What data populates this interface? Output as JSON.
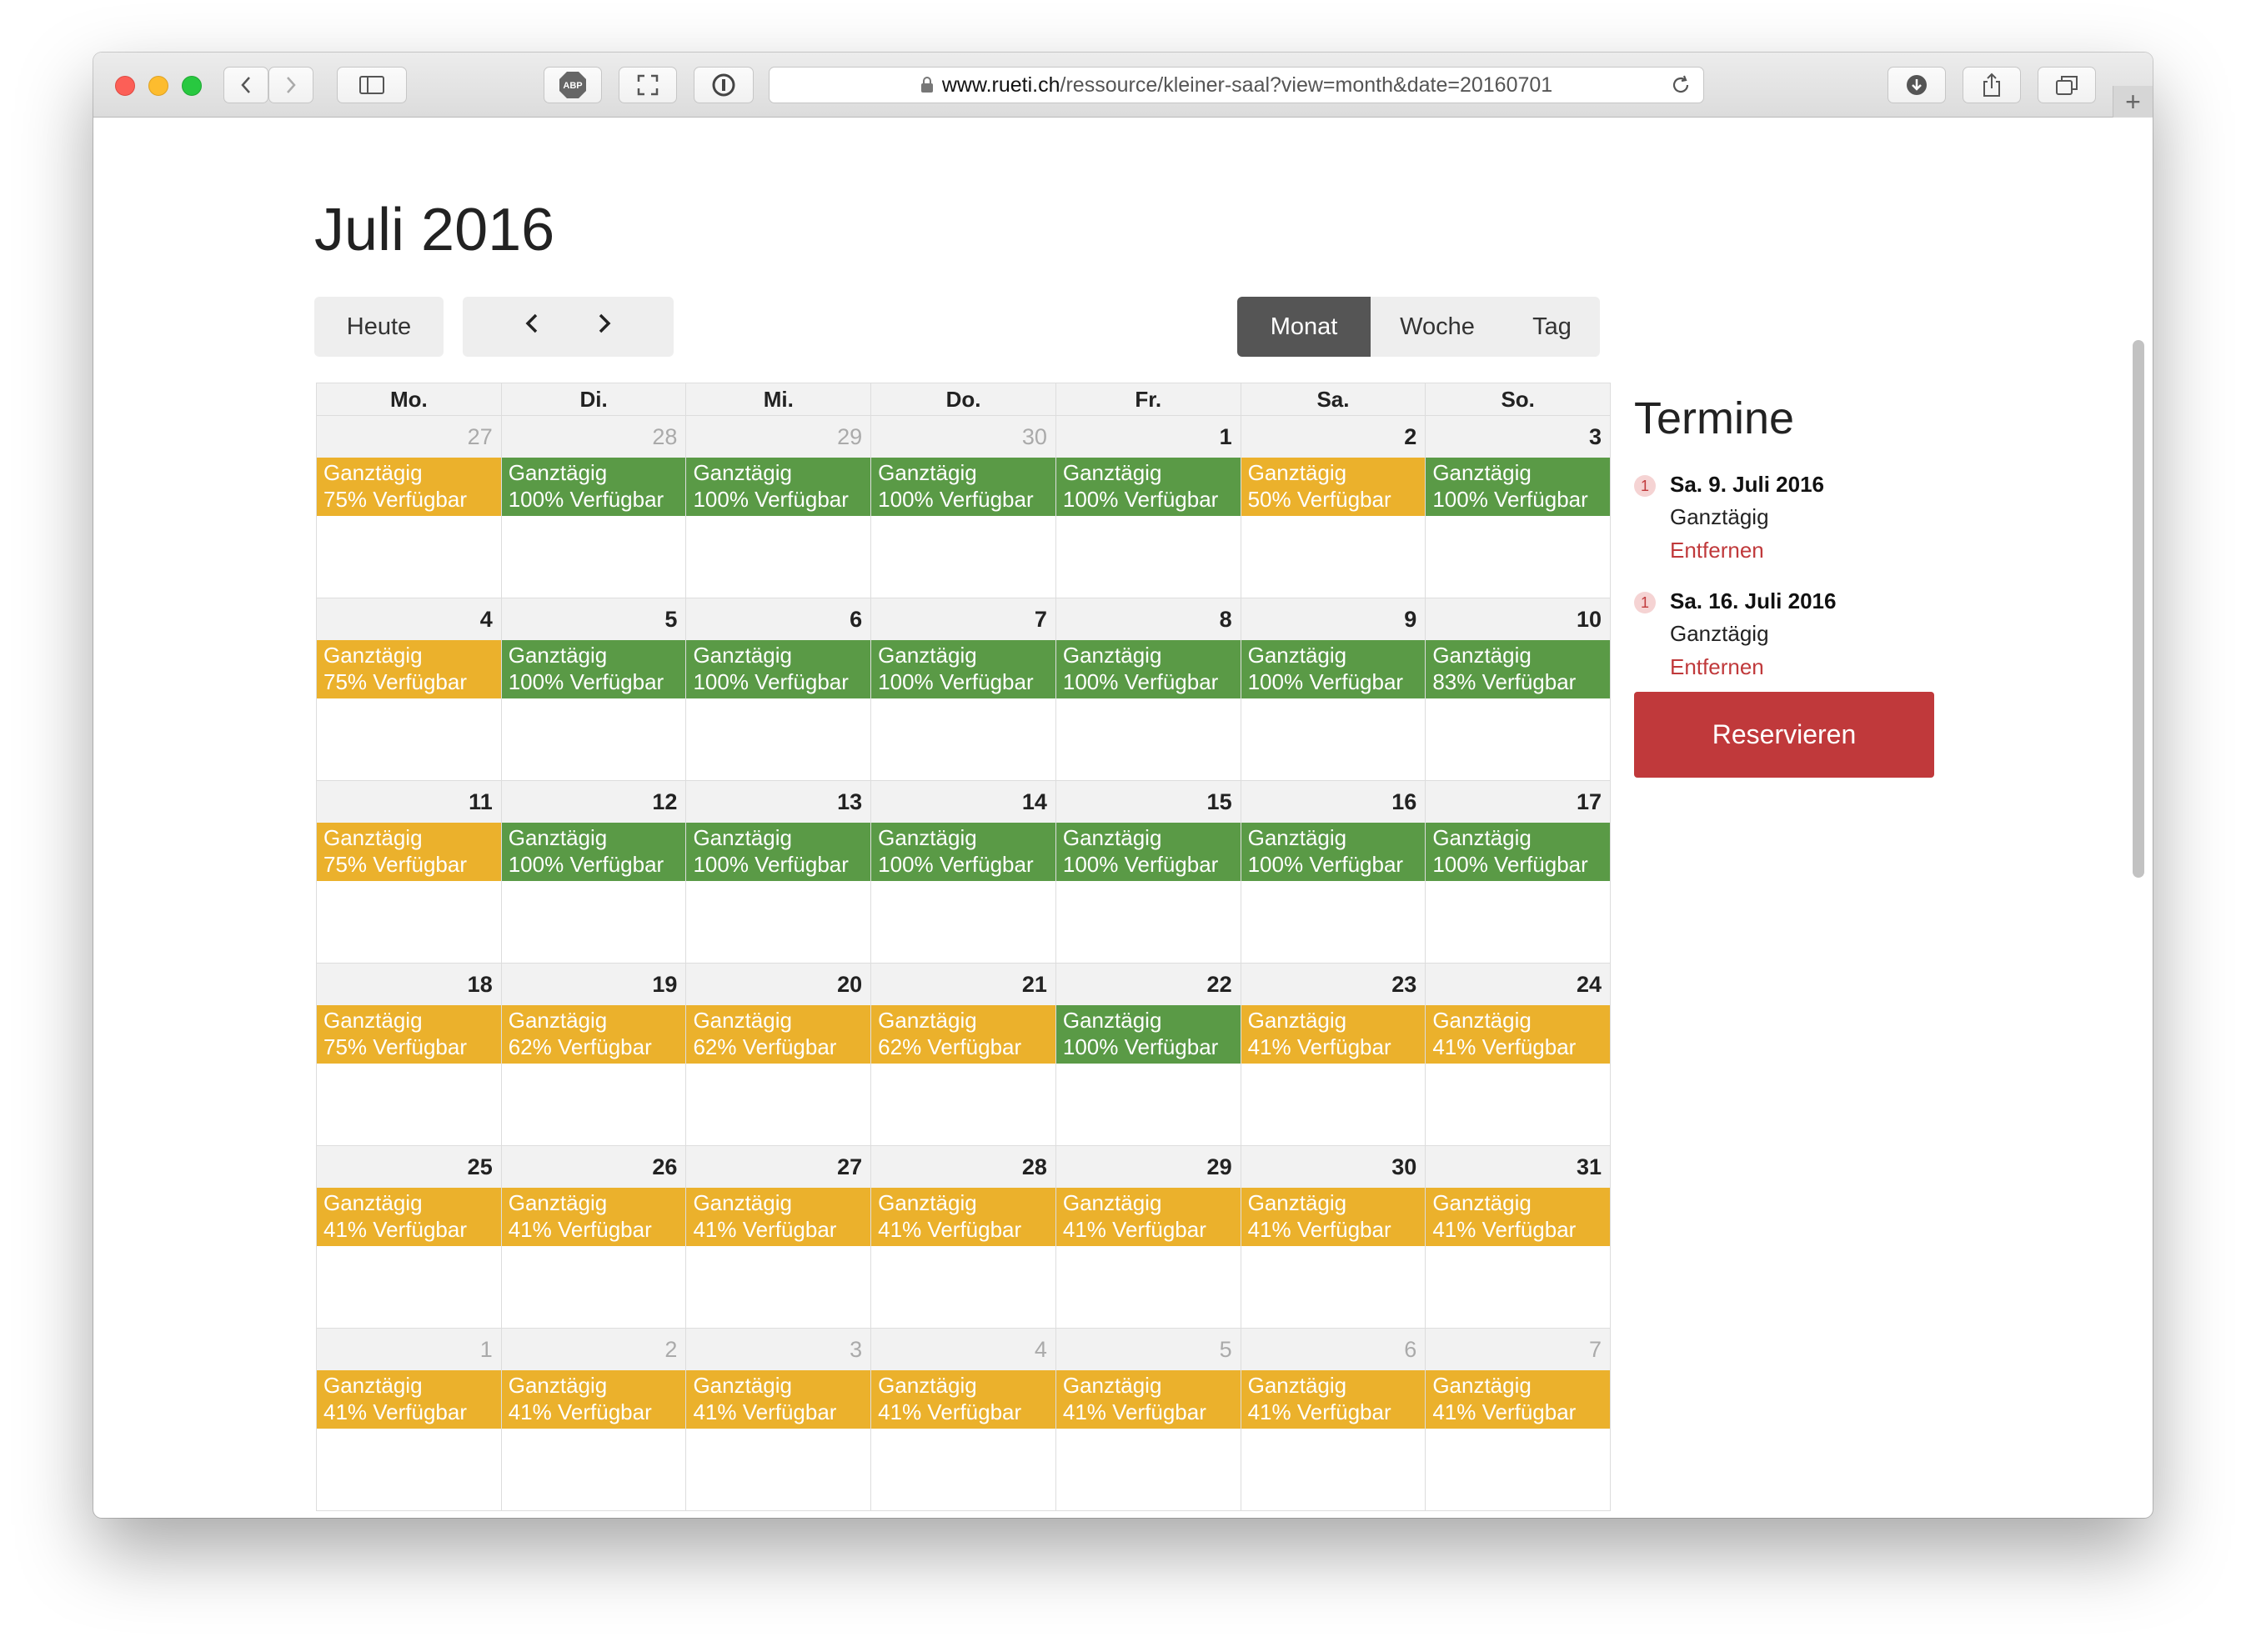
{
  "browser": {
    "url_domain": "www.rueti.ch",
    "url_path": "/ressource/kleiner-saal?view=month&date=20160701",
    "adblock_label": "ABP"
  },
  "page": {
    "title": "Juli 2016"
  },
  "controls": {
    "today": "Heute",
    "prev": "‹",
    "next": "›",
    "views": [
      "Monat",
      "Woche",
      "Tag"
    ],
    "active_view": "Monat"
  },
  "colors": {
    "available": "#5a9a46",
    "partial": "#ebb12c",
    "accent": "#c0393b"
  },
  "calendar": {
    "weekdays": [
      "Mo.",
      "Di.",
      "Mi.",
      "Do.",
      "Fr.",
      "Sa.",
      "So."
    ],
    "weeks": [
      [
        {
          "day": "27",
          "other": true,
          "label": "Ganztägig",
          "avail": "75% Verfügbar",
          "status": "yellow"
        },
        {
          "day": "28",
          "other": true,
          "label": "Ganztägig",
          "avail": "100% Verfügbar",
          "status": "green"
        },
        {
          "day": "29",
          "other": true,
          "label": "Ganztägig",
          "avail": "100% Verfügbar",
          "status": "green"
        },
        {
          "day": "30",
          "other": true,
          "label": "Ganztägig",
          "avail": "100% Verfügbar",
          "status": "green"
        },
        {
          "day": "1",
          "other": false,
          "label": "Ganztägig",
          "avail": "100% Verfügbar",
          "status": "green"
        },
        {
          "day": "2",
          "other": false,
          "label": "Ganztägig",
          "avail": "50% Verfügbar",
          "status": "yellow"
        },
        {
          "day": "3",
          "other": false,
          "label": "Ganztägig",
          "avail": "100% Verfügbar",
          "status": "green"
        }
      ],
      [
        {
          "day": "4",
          "other": false,
          "label": "Ganztägig",
          "avail": "75% Verfügbar",
          "status": "yellow"
        },
        {
          "day": "5",
          "other": false,
          "label": "Ganztägig",
          "avail": "100% Verfügbar",
          "status": "green"
        },
        {
          "day": "6",
          "other": false,
          "label": "Ganztägig",
          "avail": "100% Verfügbar",
          "status": "green"
        },
        {
          "day": "7",
          "other": false,
          "label": "Ganztägig",
          "avail": "100% Verfügbar",
          "status": "green"
        },
        {
          "day": "8",
          "other": false,
          "label": "Ganztägig",
          "avail": "100% Verfügbar",
          "status": "green"
        },
        {
          "day": "9",
          "other": false,
          "label": "Ganztägig",
          "avail": "100% Verfügbar",
          "status": "green"
        },
        {
          "day": "10",
          "other": false,
          "label": "Ganztägig",
          "avail": "83% Verfügbar",
          "status": "green"
        }
      ],
      [
        {
          "day": "11",
          "other": false,
          "label": "Ganztägig",
          "avail": "75% Verfügbar",
          "status": "yellow"
        },
        {
          "day": "12",
          "other": false,
          "label": "Ganztägig",
          "avail": "100% Verfügbar",
          "status": "green"
        },
        {
          "day": "13",
          "other": false,
          "label": "Ganztägig",
          "avail": "100% Verfügbar",
          "status": "green"
        },
        {
          "day": "14",
          "other": false,
          "label": "Ganztägig",
          "avail": "100% Verfügbar",
          "status": "green"
        },
        {
          "day": "15",
          "other": false,
          "label": "Ganztägig",
          "avail": "100% Verfügbar",
          "status": "green"
        },
        {
          "day": "16",
          "other": false,
          "label": "Ganztägig",
          "avail": "100% Verfügbar",
          "status": "green"
        },
        {
          "day": "17",
          "other": false,
          "label": "Ganztägig",
          "avail": "100% Verfügbar",
          "status": "green"
        }
      ],
      [
        {
          "day": "18",
          "other": false,
          "label": "Ganztägig",
          "avail": "75% Verfügbar",
          "status": "yellow"
        },
        {
          "day": "19",
          "other": false,
          "label": "Ganztägig",
          "avail": "62% Verfügbar",
          "status": "yellow"
        },
        {
          "day": "20",
          "other": false,
          "label": "Ganztägig",
          "avail": "62% Verfügbar",
          "status": "yellow"
        },
        {
          "day": "21",
          "other": false,
          "label": "Ganztägig",
          "avail": "62% Verfügbar",
          "status": "yellow"
        },
        {
          "day": "22",
          "other": false,
          "label": "Ganztägig",
          "avail": "100% Verfügbar",
          "status": "green"
        },
        {
          "day": "23",
          "other": false,
          "label": "Ganztägig",
          "avail": "41% Verfügbar",
          "status": "yellow"
        },
        {
          "day": "24",
          "other": false,
          "label": "Ganztägig",
          "avail": "41% Verfügbar",
          "status": "yellow"
        }
      ],
      [
        {
          "day": "25",
          "other": false,
          "label": "Ganztägig",
          "avail": "41% Verfügbar",
          "status": "yellow"
        },
        {
          "day": "26",
          "other": false,
          "label": "Ganztägig",
          "avail": "41% Verfügbar",
          "status": "yellow"
        },
        {
          "day": "27",
          "other": false,
          "label": "Ganztägig",
          "avail": "41% Verfügbar",
          "status": "yellow"
        },
        {
          "day": "28",
          "other": false,
          "label": "Ganztägig",
          "avail": "41% Verfügbar",
          "status": "yellow"
        },
        {
          "day": "29",
          "other": false,
          "label": "Ganztägig",
          "avail": "41% Verfügbar",
          "status": "yellow"
        },
        {
          "day": "30",
          "other": false,
          "label": "Ganztägig",
          "avail": "41% Verfügbar",
          "status": "yellow"
        },
        {
          "day": "31",
          "other": false,
          "label": "Ganztägig",
          "avail": "41% Verfügbar",
          "status": "yellow"
        }
      ],
      [
        {
          "day": "1",
          "other": true,
          "label": "Ganztägig",
          "avail": "41% Verfügbar",
          "status": "yellow"
        },
        {
          "day": "2",
          "other": true,
          "label": "Ganztägig",
          "avail": "41% Verfügbar",
          "status": "yellow"
        },
        {
          "day": "3",
          "other": true,
          "label": "Ganztägig",
          "avail": "41% Verfügbar",
          "status": "yellow"
        },
        {
          "day": "4",
          "other": true,
          "label": "Ganztägig",
          "avail": "41% Verfügbar",
          "status": "yellow"
        },
        {
          "day": "5",
          "other": true,
          "label": "Ganztägig",
          "avail": "41% Verfügbar",
          "status": "yellow"
        },
        {
          "day": "6",
          "other": true,
          "label": "Ganztägig",
          "avail": "41% Verfügbar",
          "status": "yellow"
        },
        {
          "day": "7",
          "other": true,
          "label": "Ganztägig",
          "avail": "41% Verfügbar",
          "status": "yellow"
        }
      ]
    ]
  },
  "sidebar": {
    "title": "Termine",
    "appointments": [
      {
        "count": "1",
        "date": "Sa. 9. Juli 2016",
        "type": "Ganztägig",
        "remove": "Entfernen"
      },
      {
        "count": "1",
        "date": "Sa. 16. Juli 2016",
        "type": "Ganztägig",
        "remove": "Entfernen"
      }
    ],
    "reserve_label": "Reservieren"
  },
  "icons": [
    "back-icon",
    "forward-icon",
    "sidebar-icon",
    "adblock-icon",
    "fullscreen-icon",
    "info-icon",
    "lock-icon",
    "reload-icon",
    "download-icon",
    "share-icon",
    "tabs-icon",
    "plus-icon"
  ]
}
